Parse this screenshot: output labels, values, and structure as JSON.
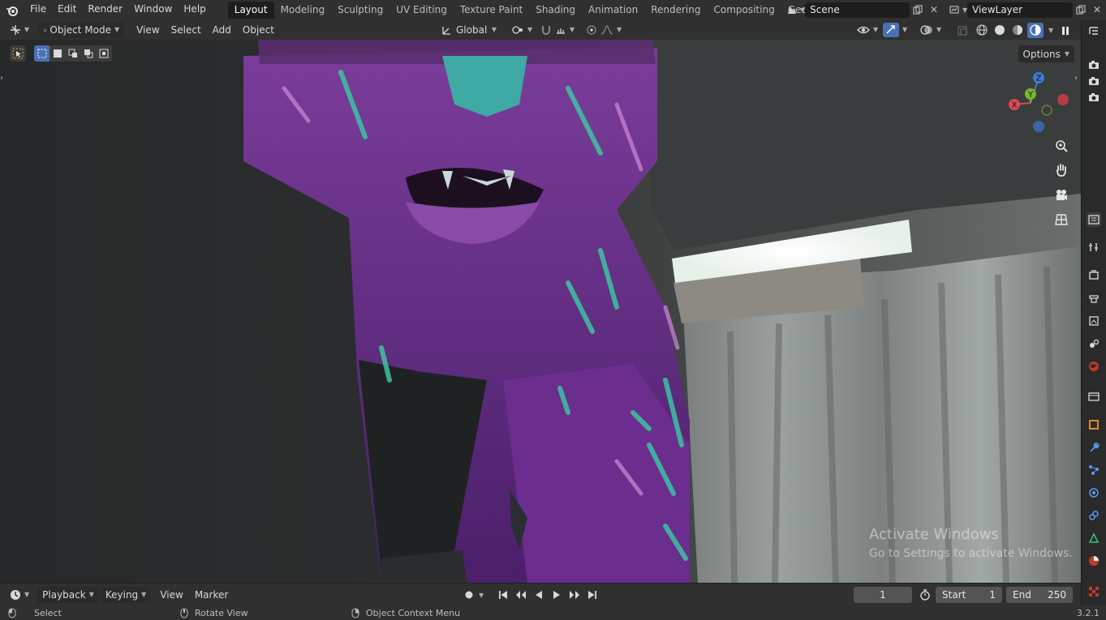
{
  "topbar": {
    "menus": [
      "File",
      "Edit",
      "Render",
      "Window",
      "Help"
    ],
    "workspaces": [
      {
        "label": "Layout",
        "active": true
      },
      {
        "label": "Modeling",
        "active": false
      },
      {
        "label": "Sculpting",
        "active": false
      },
      {
        "label": "UV Editing",
        "active": false
      },
      {
        "label": "Texture Paint",
        "active": false
      },
      {
        "label": "Shading",
        "active": false
      },
      {
        "label": "Animation",
        "active": false
      },
      {
        "label": "Rendering",
        "active": false
      },
      {
        "label": "Compositing",
        "active": false
      },
      {
        "label": "Geometry Noc",
        "active": false
      }
    ],
    "scene": "Scene",
    "view_layer": "ViewLayer"
  },
  "header": {
    "mode": "Object Mode",
    "menus": [
      "View",
      "Select",
      "Add",
      "Object"
    ],
    "orientation": "Global"
  },
  "viewport": {
    "options_label": "Options",
    "gizmo": {
      "x": "X",
      "y": "Y",
      "z": "Z"
    },
    "watermark_title": "Activate Windows",
    "watermark_sub": "Go to Settings to activate Windows."
  },
  "timeline": {
    "menus": [
      "Playback",
      "Keying",
      "View",
      "Marker"
    ],
    "current_frame": "1",
    "start_label": "Start",
    "start_value": "1",
    "end_label": "End",
    "end_value": "250"
  },
  "statusbar": {
    "select": "Select",
    "rotate": "Rotate View",
    "context": "Object Context Menu",
    "version": "3.2.1"
  },
  "colors": {
    "panel": "#303030",
    "accent": "#4772b3",
    "active_tab": "#1d1d1d"
  }
}
